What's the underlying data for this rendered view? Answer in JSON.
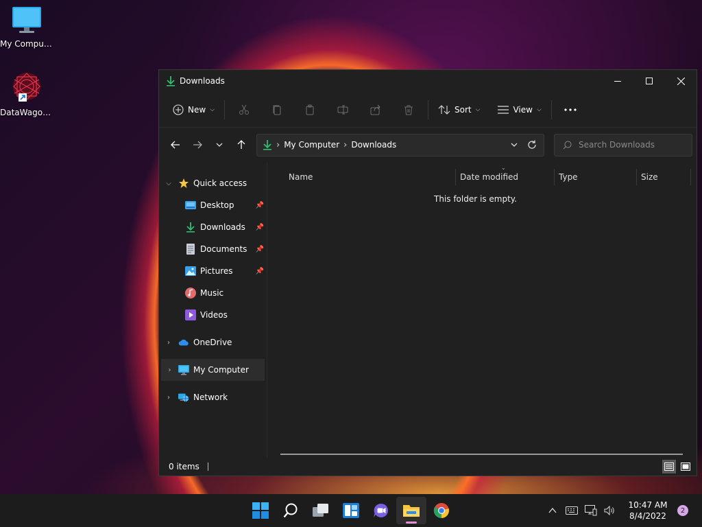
{
  "desktop": {
    "icons": [
      {
        "label": "My Computer",
        "icon": "monitor-icon"
      },
      {
        "label": "DataWagon...",
        "icon": "datawagon-app-icon"
      }
    ]
  },
  "window": {
    "title": "Downloads",
    "controls": {
      "minimize": "minimize-icon",
      "maximize": "maximize-icon",
      "close": "close-icon"
    },
    "commandbar": {
      "new_label": "New",
      "sort_label": "Sort",
      "view_label": "View",
      "disabled_icons": [
        "cut-icon",
        "copy-icon",
        "paste-icon",
        "rename-icon",
        "share-icon",
        "delete-icon"
      ]
    },
    "address": {
      "crumbs": [
        "My Computer",
        "Downloads"
      ]
    },
    "search": {
      "placeholder": "Search Downloads"
    },
    "sidebar": {
      "quick_access": "Quick access",
      "items": [
        {
          "label": "Desktop",
          "pinned": true
        },
        {
          "label": "Downloads",
          "pinned": true
        },
        {
          "label": "Documents",
          "pinned": true
        },
        {
          "label": "Pictures",
          "pinned": true
        },
        {
          "label": "Music",
          "pinned": false
        },
        {
          "label": "Videos",
          "pinned": false
        }
      ],
      "onedrive": "OneDrive",
      "my_computer": "My Computer",
      "network": "Network"
    },
    "columns": {
      "name": "Name",
      "date": "Date modified",
      "type": "Type",
      "size": "Size"
    },
    "empty_message": "This folder is empty.",
    "status": {
      "items": "0 items"
    }
  },
  "taskbar": {
    "apps": [
      "start-icon",
      "search-icon",
      "task-view-icon",
      "widgets-icon",
      "chat-icon",
      "file-explorer-icon",
      "chrome-icon"
    ],
    "time": "10:47 AM",
    "date": "8/4/2022",
    "notifications": "2"
  },
  "colors": {
    "accent_green": "#2fbf71",
    "folder_yellow": "#f5c742",
    "selection": "#2d2d2d"
  }
}
